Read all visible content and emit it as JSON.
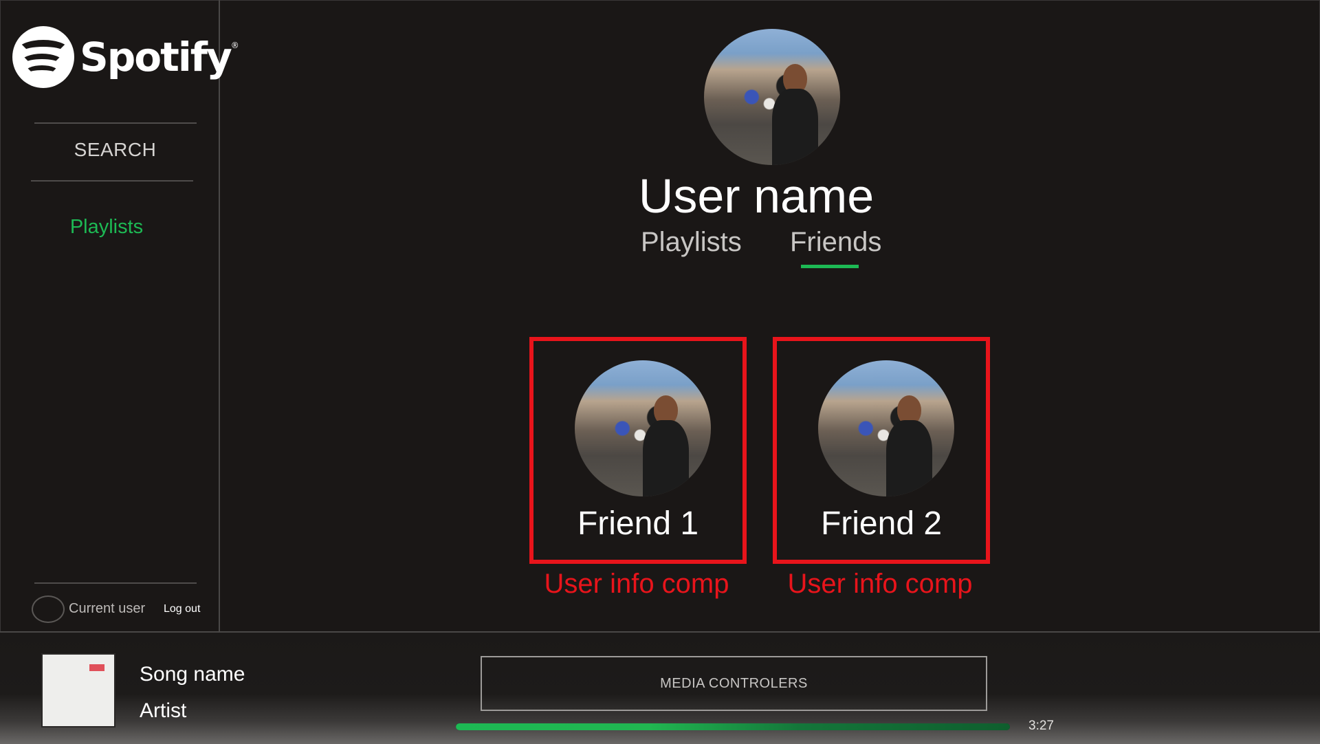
{
  "app": {
    "logo_text": "Spotify",
    "logo_reg": "®"
  },
  "sidebar": {
    "search_label": "SEARCH",
    "nav": [
      {
        "label": "Playlists",
        "active": true
      }
    ],
    "current_user_label": "Current user",
    "logout_label": "Log out"
  },
  "profile": {
    "user_name": "User name",
    "tabs": [
      {
        "label": "Playlists",
        "active": false
      },
      {
        "label": "Friends",
        "active": true
      }
    ]
  },
  "friends": [
    {
      "name": "Friend 1",
      "annotation": "User info comp"
    },
    {
      "name": "Friend 2",
      "annotation": "User info comp"
    }
  ],
  "player": {
    "song_name": "Song name",
    "artist": "Artist",
    "media_controls_label": "MEDIA CONTROLERS",
    "duration": "3:27",
    "progress": 1.0
  },
  "colors": {
    "accent_green": "#1db954",
    "annotation_red": "#e8141b",
    "background": "#1a1716"
  }
}
